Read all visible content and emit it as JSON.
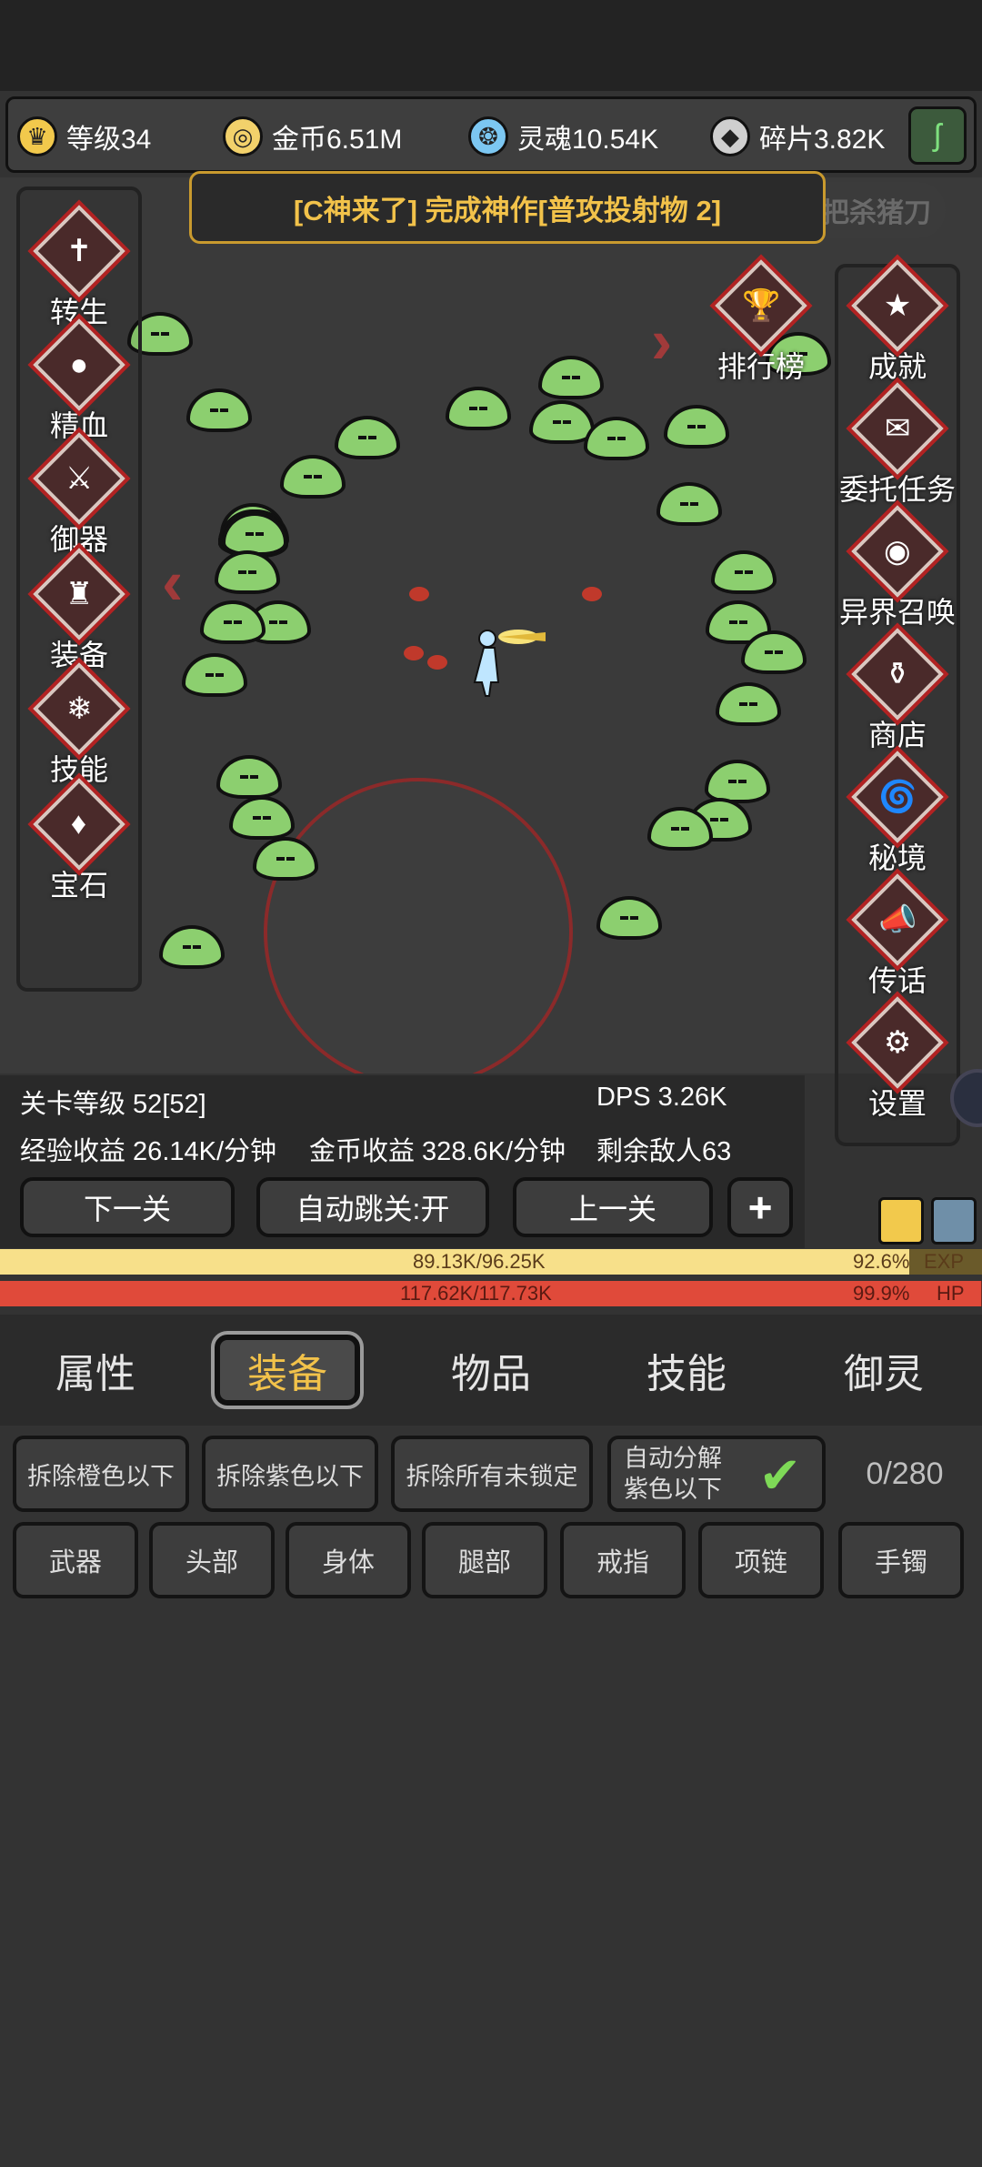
{
  "resources": [
    {
      "label": "等级34",
      "icon": "crown-icon",
      "color": "#f2c94c"
    },
    {
      "label": "金币6.51M",
      "icon": "gold-coin-icon",
      "color": "#f2d16b"
    },
    {
      "label": "灵魂10.54K",
      "icon": "soul-drop-icon",
      "color": "#7cc7f2"
    },
    {
      "label": "碎片3.82K",
      "icon": "shard-icon",
      "color": "#cfcfcf"
    }
  ],
  "banner": {
    "text": "[C神来了] 完成神作[普攻投射物 2]",
    "tail": "一把杀猪刀"
  },
  "left_menu": [
    "转生",
    "精血",
    "御器",
    "装备",
    "技能",
    "宝石"
  ],
  "right_menu": [
    "排行榜",
    "成就",
    "委托任务",
    "异界召唤",
    "商店",
    "秘境",
    "传话",
    "设置"
  ],
  "stage": {
    "level": "关卡等级 52[52]",
    "dps": "DPS 3.26K",
    "exp_rate": "经验收益 26.14K/分钟",
    "gold_rate": "金币收益 328.6K/分钟",
    "enemies": "剩余敌人63"
  },
  "controls": {
    "next": "下一关",
    "auto": "自动跳关:开",
    "prev": "上一关",
    "plus": "+"
  },
  "exp_bar": {
    "value": "89.13K/96.25K",
    "percent": "92.6%",
    "label": "EXP",
    "fill": 0.926,
    "color": "#f7e08a"
  },
  "hp_bar": {
    "value": "117.62K/117.73K",
    "percent": "99.9%",
    "label": "HP",
    "fill": 0.999,
    "color": "#e04a3a"
  },
  "tabs": [
    "属性",
    "装备",
    "物品",
    "技能",
    "御灵"
  ],
  "active_tab": "装备",
  "dismantle": {
    "orange": "拆除橙色以下",
    "purple": "拆除紫色以下",
    "unlocked": "拆除所有未锁定",
    "auto_line1": "自动分解",
    "auto_line2": "紫色以下",
    "count": "0/280"
  },
  "slots": [
    "武器",
    "头部",
    "身体",
    "腿部",
    "戒指",
    "项链",
    "手镯"
  ]
}
